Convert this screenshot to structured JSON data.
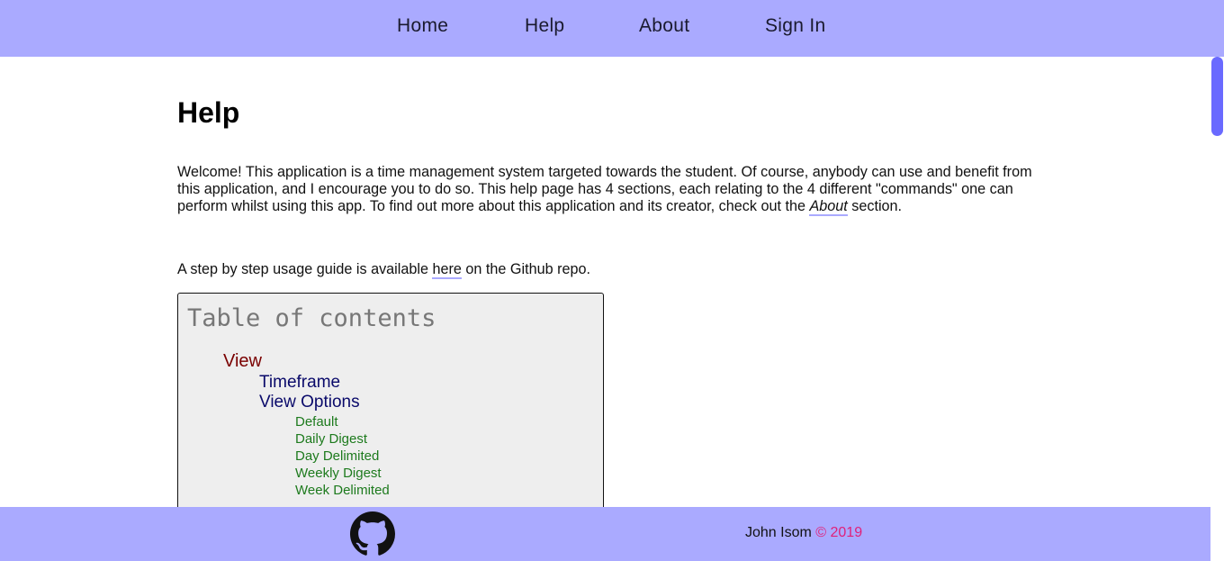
{
  "nav": {
    "items": [
      "Home",
      "Help",
      "About",
      "Sign In"
    ]
  },
  "main": {
    "title": "Help",
    "intro_before_link": "Welcome! This application is a time management system targeted towards the student. Of course, anybody can use and benefit from this application, and I encourage you to do so. This help page has 4 sections, each relating to the 4 different \"commands\" one can perform whilst using this app. To find out more about this application and its creator, check out the ",
    "intro_link": "About",
    "intro_after_link": " section.",
    "guide_before_link": "A step by step usage guide is available ",
    "guide_link": "here",
    "guide_after_link": " on the Github repo."
  },
  "toc": {
    "title": "Table of contents",
    "level1": [
      "View"
    ],
    "level2": [
      "Timeframe",
      "View Options"
    ],
    "level3": [
      "Default",
      "Daily Digest",
      "Day Delimited",
      "Weekly Digest",
      "Week Delimited"
    ]
  },
  "footer": {
    "github_icon": "github-icon",
    "author": "John Isom",
    "copyright": "© 2019"
  },
  "colors": {
    "nav_bg": "#aaaaff",
    "toc_level1": "#7a0000",
    "toc_level2": "#0a0a6a",
    "toc_level3": "#1d7a1d",
    "copyright": "#e0207a"
  }
}
